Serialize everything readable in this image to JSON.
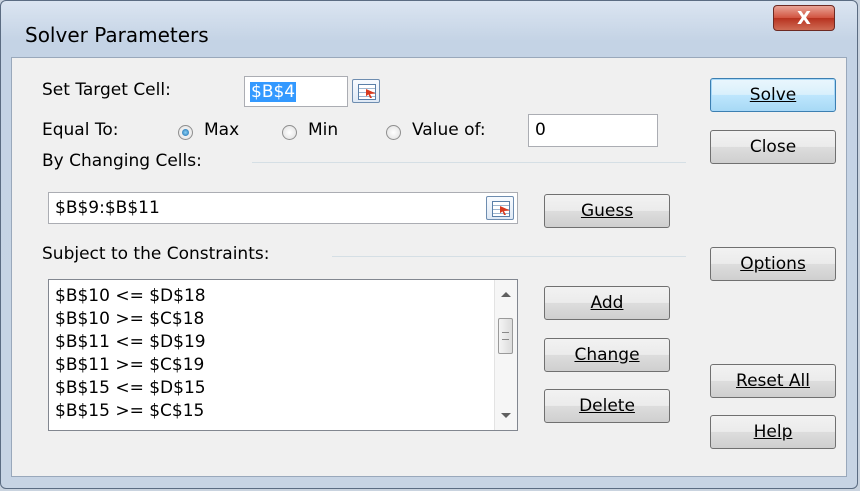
{
  "window": {
    "title": "Solver Parameters",
    "close_glyph": "X"
  },
  "target": {
    "label": "Set Target Cell:",
    "value": "$B$4"
  },
  "equal_to": {
    "label": "Equal To:",
    "options": [
      {
        "label": "Max",
        "selected": true
      },
      {
        "label": "Min",
        "selected": false
      },
      {
        "label": "Value of:",
        "selected": false
      }
    ],
    "value_of": "0"
  },
  "changing": {
    "label": "By Changing Cells:",
    "value": "$B$9:$B$11",
    "guess_button": "Guess"
  },
  "constraints": {
    "label": "Subject to the Constraints:",
    "items": [
      "$B$10 <= $D$18",
      "$B$10 >= $C$18",
      "$B$11 <= $D$19",
      "$B$11 >= $C$19",
      "$B$15 <= $D$15",
      "$B$15 >= $C$15"
    ],
    "add_button": "Add",
    "change_button": "Change",
    "delete_button": "Delete"
  },
  "side_buttons": {
    "solve": "Solve",
    "close": "Close",
    "options": "Options",
    "reset_all": "Reset All",
    "help": "Help"
  },
  "colors": {
    "selection": "#3399ff",
    "default_border": "#3c7fb1",
    "close_red": "#c84a35"
  },
  "icons": {
    "cell_ref": "collapse-dialog-icon",
    "scroll_up": "scroll-up-arrow-icon",
    "scroll_down": "scroll-down-arrow-icon"
  }
}
